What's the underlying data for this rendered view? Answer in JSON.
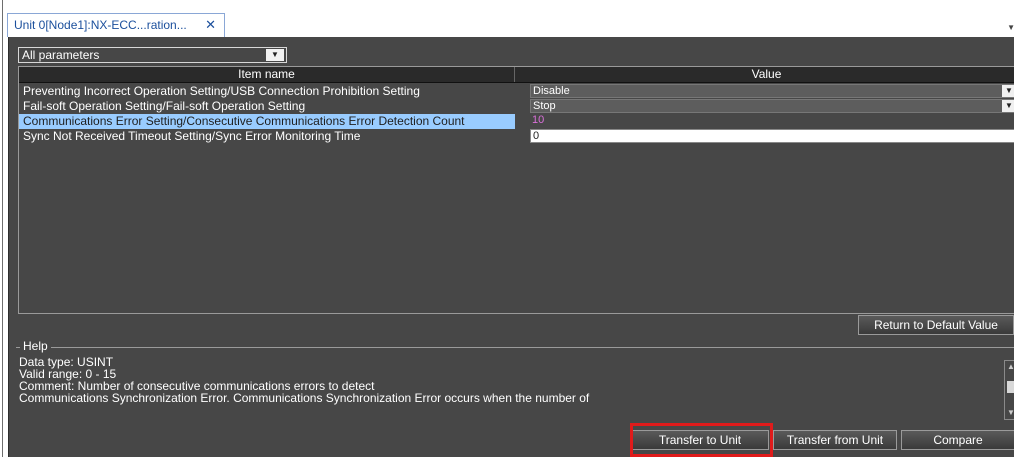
{
  "tab": {
    "title": "Unit 0[Node1]:NX-ECC...ration...",
    "close_glyph": "✕",
    "menu_glyph": "▼"
  },
  "filter": {
    "selected": "All parameters",
    "arrow_glyph": "▼"
  },
  "grid": {
    "columns": [
      "Item name",
      "Value"
    ],
    "rows": [
      {
        "name": "Preventing Incorrect Operation Setting/USB Connection Prohibition Setting",
        "value": "Disable",
        "type": "combo",
        "selected": false
      },
      {
        "name": "Fail-soft Operation Setting/Fail-soft Operation Setting",
        "value": "Stop",
        "type": "combo",
        "selected": false
      },
      {
        "name": "Communications Error Setting/Consecutive Communications Error Detection Count",
        "value": "10",
        "type": "plain",
        "selected": true
      },
      {
        "name": "Sync Not Received Timeout Setting/Sync Error Monitoring Time",
        "value": "0",
        "type": "text",
        "selected": false
      }
    ],
    "combo_arrow_glyph": "▼"
  },
  "buttons": {
    "return_default": "Return to Default Value",
    "transfer_to_unit": "Transfer to Unit",
    "transfer_from_unit": "Transfer from Unit",
    "compare": "Compare"
  },
  "help": {
    "legend": "Help",
    "lines": [
      "Data type: USINT",
      "Valid range: 0 - 15",
      "Comment: Number of consecutive communications errors to detect",
      "Communications Synchronization Error. Communications Synchronization Error occurs when the number of"
    ]
  },
  "colors": {
    "panel_bg": "#474747",
    "selection": "#99ccff",
    "highlight_box": "#e01b1b",
    "tab_text": "#1b4f9c"
  }
}
